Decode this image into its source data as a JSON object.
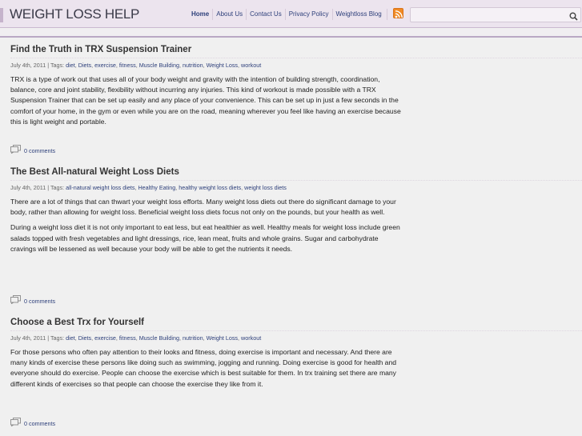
{
  "header": {
    "site_title": "WEIGHT LOSS HELP",
    "nav": [
      "Home",
      "About Us",
      "Contact Us",
      "Privacy Policy",
      "Weightloss Blog"
    ],
    "rss_icon": "rss-feed-icon",
    "search": {
      "value": "",
      "placeholder": "",
      "icon": "search-icon"
    }
  },
  "posts": [
    {
      "title": "Find the Truth in TRX Suspension Trainer",
      "date": "July 4th, 2011",
      "tags_label": "Tags:",
      "tags": [
        "diet",
        "Diets",
        "exercise",
        "fitness",
        "Muscle Building",
        "nutrition",
        "Weight Loss",
        "workout"
      ],
      "paragraphs": [
        "TRX is a type of work out that uses all of your body weight and gravity with the intention of building strength, coordination, balance, core and joint stability, flexibility without incurring any injuries. This kind of workout is made possible with a TRX Suspension Trainer that can be set up easily and any place of your convenience. This can be set up in just a few seconds in the comfort of your home, in the gym or even while you are on the road, meaning wherever you feel like having an exercise because this is light weight and portable."
      ],
      "comments": "0 comments"
    },
    {
      "title": "The Best All-natural Weight Loss Diets",
      "date": "July 4th, 2011",
      "tags_label": "Tags:",
      "tags": [
        "all-natural weight loss diets",
        "Healthy Eating",
        "healthy weight loss diets",
        "weight loss diets"
      ],
      "paragraphs": [
        "There are a lot of things that can thwart your weight loss efforts. Many weight loss diets out there do significant damage to your body, rather than allowing for weight loss. Beneficial weight loss diets focus not only on the pounds, but your health as well.",
        "During a weight loss diet it is not only important to eat less, but eat healthier as well. Healthy meals for weight loss include green salads topped with fresh vegetables and light dressings, rice, lean meat, fruits and whole grains. Sugar and carbohydrate cravings will be lessened as well because your body will be able to get the nutrients it needs."
      ],
      "comments": "0 comments"
    },
    {
      "title": "Choose a Best Trx for Yourself",
      "date": "July 4th, 2011",
      "tags_label": "Tags:",
      "tags": [
        "diet",
        "Diets",
        "exercise",
        "fitness",
        "Muscle Building",
        "nutrition",
        "Weight Loss",
        "workout"
      ],
      "paragraphs": [
        "For those persons who often pay attention to their looks and fitness, doing exercise is important and necessary. And there are many kinds of exercise these persons like doing such as swimming, jogging and running. Doing exercise is good for health and everyone should do exercise. People can choose the exercise which is best suitable for them. In trx training set there are many different kinds of exercises so that people can choose the exercise they like from it."
      ],
      "comments": "0 comments"
    }
  ],
  "colors": {
    "header_bg": "#ece4ee",
    "accent_line": "#b9a8c4",
    "link": "#2d3f7a",
    "rss": "#f08a24",
    "page_bg": "#f0f0f0"
  }
}
